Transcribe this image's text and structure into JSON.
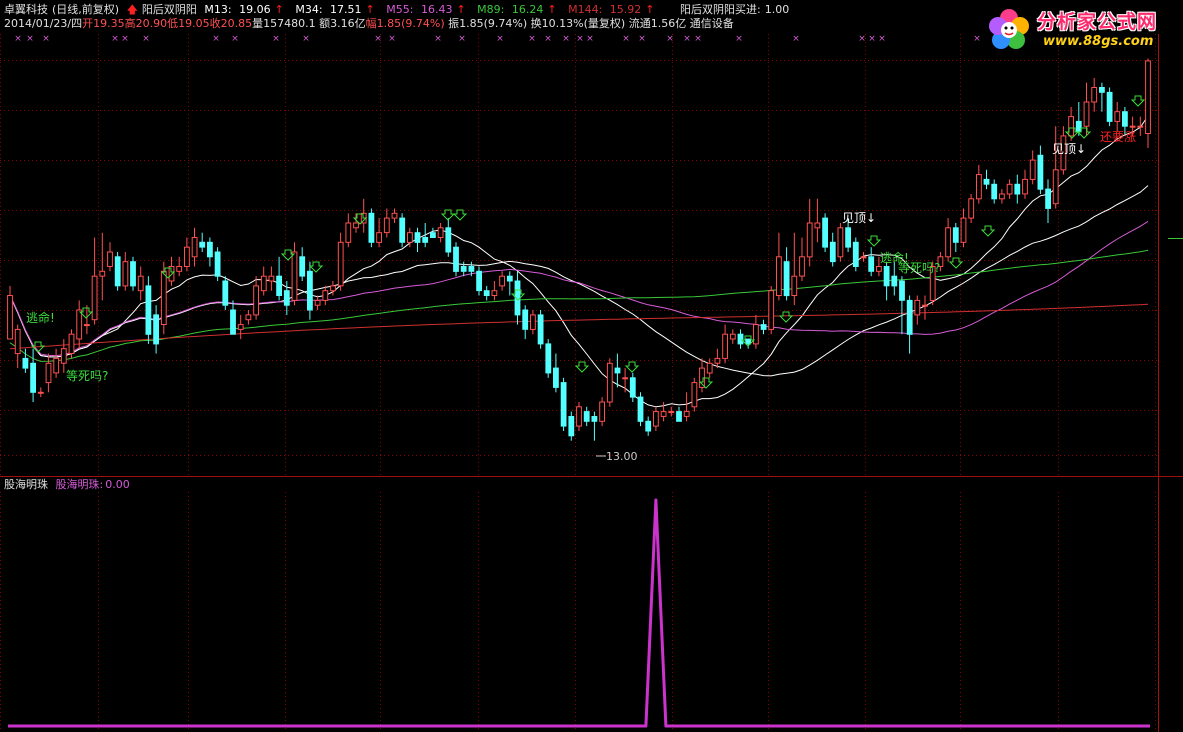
{
  "header": {
    "stock_name": "卓翼科技",
    "period": "(日线,前复权)",
    "indicator_name": "阳后双阴阳",
    "mas": [
      {
        "label": "M13:",
        "value": "19.06",
        "color": "#ffffff"
      },
      {
        "label": "M34:",
        "value": "17.51",
        "color": "#ffffff"
      },
      {
        "label": "M55:",
        "value": "16.43",
        "color": "#d65cd6"
      },
      {
        "label": "M89:",
        "value": "16.24",
        "color": "#38c838"
      },
      {
        "label": "M144:",
        "value": "15.92",
        "color": "#d03030"
      }
    ],
    "buy_signal_label": "阳后双阴阳买进:",
    "buy_signal_value": "1.00",
    "info_date": "2014/01/23/四",
    "info_open": "开19.35",
    "info_high": "高20.90",
    "info_low": "低19.05",
    "info_close": "收20.85",
    "info_volume": "量157480.1",
    "info_amount": "额3.16亿",
    "info_change": "幅1.85(9.74%)",
    "info_amplitude": "振1.85(9.74%)",
    "info_turnover": "换10.13%(量复权)",
    "info_float": "流通1.56亿",
    "info_sector": "通信设备"
  },
  "logo": {
    "title": "分析家公式网",
    "url": "www.88gs.com"
  },
  "annotations": {
    "escape": "逃命!",
    "wait_death": "等死吗?",
    "see_top": "见顶",
    "still_rising": "还要涨",
    "low_price": "13.00"
  },
  "sub_panel": {
    "title": "股海明珠",
    "indicator_label": "股海明珠:",
    "value": "0.00"
  },
  "colors": {
    "up_candle": "#ff5050",
    "down_candle": "#54ffff",
    "ma13": "#ffffff",
    "ma34": "#ffffff",
    "ma55": "#d65cd6",
    "ma89": "#38c838",
    "ma144": "#d03030",
    "signal_green": "#3cdc3c",
    "osc_line": "#cc33cc",
    "grid": "#8b0000",
    "arrow_up": "#ff2020"
  },
  "chart_data": {
    "type": "candlestick",
    "ylim": [
      12.6,
      21.2
    ],
    "low_marker": 13.0,
    "candles": [
      [
        15.1,
        16.0,
        15.1,
        16.2
      ],
      [
        14.8,
        15.3,
        14.5,
        15.4
      ],
      [
        14.7,
        14.5,
        14.4,
        14.9
      ],
      [
        14.6,
        14.0,
        13.8,
        14.9
      ],
      [
        14.0,
        14.0,
        13.9,
        14.1
      ],
      [
        14.2,
        14.6,
        14.0,
        14.8
      ],
      [
        14.4,
        14.7,
        14.3,
        14.9
      ],
      [
        14.6,
        14.9,
        14.4,
        15.1
      ],
      [
        14.8,
        15.2,
        14.7,
        15.3
      ],
      [
        15.1,
        15.7,
        14.9,
        15.9
      ],
      [
        15.4,
        15.4,
        15.2,
        15.8
      ],
      [
        15.5,
        16.4,
        15.4,
        17.2
      ],
      [
        16.4,
        16.5,
        15.9,
        17.3
      ],
      [
        16.6,
        16.9,
        16.5,
        17.1
      ],
      [
        16.8,
        16.2,
        16.1,
        16.9
      ],
      [
        16.2,
        16.7,
        16.1,
        16.9
      ],
      [
        16.7,
        16.2,
        16.1,
        16.8
      ],
      [
        16.1,
        16.4,
        15.9,
        16.6
      ],
      [
        16.2,
        15.2,
        15.0,
        16.4
      ],
      [
        15.6,
        15.0,
        14.8,
        15.8
      ],
      [
        15.4,
        16.5,
        15.2,
        16.7
      ],
      [
        16.3,
        16.6,
        16.2,
        16.8
      ],
      [
        16.5,
        16.6,
        16.4,
        16.8
      ],
      [
        16.6,
        17.0,
        16.5,
        17.2
      ],
      [
        16.8,
        17.2,
        16.6,
        17.4
      ],
      [
        17.1,
        17.0,
        16.9,
        17.3
      ],
      [
        17.1,
        16.8,
        16.6,
        17.2
      ],
      [
        16.9,
        16.4,
        16.3,
        17.0
      ],
      [
        16.3,
        15.8,
        15.7,
        16.4
      ],
      [
        15.7,
        15.2,
        15.2,
        15.9
      ],
      [
        15.3,
        15.4,
        15.1,
        15.6
      ],
      [
        15.5,
        15.6,
        15.4,
        15.7
      ],
      [
        15.6,
        16.2,
        15.5,
        16.4
      ],
      [
        16.1,
        16.4,
        16.0,
        16.6
      ],
      [
        16.3,
        16.4,
        16.1,
        16.6
      ],
      [
        16.4,
        16.0,
        15.9,
        16.8
      ],
      [
        16.1,
        15.8,
        15.6,
        16.3
      ],
      [
        15.9,
        16.9,
        15.8,
        17.1
      ],
      [
        16.8,
        16.4,
        16.3,
        17.0
      ],
      [
        16.5,
        15.7,
        15.5,
        16.7
      ],
      [
        15.8,
        15.9,
        15.7,
        16.0
      ],
      [
        15.9,
        16.1,
        15.8,
        16.2
      ],
      [
        16.1,
        16.2,
        16.0,
        16.3
      ],
      [
        16.2,
        17.1,
        16.1,
        17.3
      ],
      [
        17.1,
        17.5,
        17.0,
        17.7
      ],
      [
        17.4,
        17.5,
        17.3,
        17.7
      ],
      [
        17.5,
        17.7,
        17.3,
        18.0
      ],
      [
        17.7,
        17.1,
        17.0,
        17.8
      ],
      [
        17.1,
        17.3,
        17.0,
        17.6
      ],
      [
        17.3,
        17.6,
        17.2,
        17.8
      ],
      [
        17.6,
        17.7,
        17.5,
        17.8
      ],
      [
        17.6,
        17.1,
        17.0,
        17.7
      ],
      [
        17.1,
        17.3,
        17.0,
        17.4
      ],
      [
        17.3,
        17.1,
        16.9,
        17.4
      ],
      [
        17.2,
        17.1,
        17.0,
        17.5
      ],
      [
        17.3,
        17.2,
        17.2,
        17.4
      ],
      [
        17.2,
        17.4,
        17.1,
        17.5
      ],
      [
        17.4,
        16.9,
        16.8,
        17.6
      ],
      [
        17.0,
        16.5,
        16.4,
        17.1
      ],
      [
        16.6,
        16.5,
        16.4,
        16.7
      ],
      [
        16.6,
        16.5,
        16.4,
        16.7
      ],
      [
        16.5,
        16.1,
        16.0,
        16.6
      ],
      [
        16.1,
        16.0,
        15.9,
        16.2
      ],
      [
        16.0,
        16.1,
        15.9,
        16.3
      ],
      [
        16.2,
        16.4,
        16.1,
        16.5
      ],
      [
        16.4,
        16.3,
        16.0,
        16.5
      ],
      [
        16.3,
        15.6,
        15.4,
        16.5
      ],
      [
        15.7,
        15.3,
        15.1,
        15.8
      ],
      [
        15.3,
        15.6,
        15.2,
        15.7
      ],
      [
        15.6,
        15.0,
        14.9,
        15.7
      ],
      [
        15.0,
        14.4,
        14.3,
        15.1
      ],
      [
        14.5,
        14.1,
        14.0,
        14.8
      ],
      [
        14.2,
        13.3,
        13.2,
        14.3
      ],
      [
        13.5,
        13.1,
        13.0,
        13.6
      ],
      [
        13.3,
        13.7,
        13.2,
        13.8
      ],
      [
        13.6,
        13.4,
        13.3,
        13.7
      ],
      [
        13.5,
        13.4,
        13.0,
        13.6
      ],
      [
        13.4,
        13.8,
        13.3,
        13.9
      ],
      [
        13.8,
        14.6,
        13.7,
        14.7
      ],
      [
        14.5,
        14.4,
        14.1,
        14.8
      ],
      [
        14.3,
        14.3,
        14.0,
        14.5
      ],
      [
        14.3,
        13.9,
        13.8,
        14.4
      ],
      [
        13.9,
        13.4,
        13.3,
        14.0
      ],
      [
        13.4,
        13.2,
        13.1,
        13.5
      ],
      [
        13.3,
        13.6,
        13.2,
        13.7
      ],
      [
        13.5,
        13.6,
        13.4,
        13.8
      ],
      [
        13.6,
        13.6,
        13.5,
        13.7
      ],
      [
        13.6,
        13.4,
        13.4,
        13.7
      ],
      [
        13.5,
        13.6,
        13.4,
        14.0
      ],
      [
        13.7,
        14.2,
        13.6,
        14.3
      ],
      [
        14.1,
        14.5,
        14.0,
        14.7
      ],
      [
        14.4,
        14.6,
        14.3,
        14.7
      ],
      [
        14.6,
        14.7,
        14.5,
        14.9
      ],
      [
        14.7,
        15.2,
        14.6,
        15.4
      ],
      [
        15.1,
        15.2,
        15.0,
        15.3
      ],
      [
        15.2,
        15.0,
        14.9,
        15.3
      ],
      [
        15.1,
        15.0,
        14.9,
        15.1
      ],
      [
        15.0,
        15.4,
        14.9,
        15.6
      ],
      [
        15.4,
        15.3,
        15.2,
        15.5
      ],
      [
        15.3,
        16.1,
        15.2,
        16.2
      ],
      [
        16.0,
        16.8,
        15.9,
        17.3
      ],
      [
        16.7,
        16.0,
        15.9,
        17.0
      ],
      [
        16.0,
        16.4,
        15.8,
        17.3
      ],
      [
        16.4,
        16.8,
        16.3,
        17.2
      ],
      [
        16.8,
        17.5,
        16.6,
        18.0
      ],
      [
        17.4,
        17.5,
        17.1,
        18.0
      ],
      [
        17.6,
        17.0,
        16.9,
        17.7
      ],
      [
        17.1,
        16.7,
        16.6,
        17.3
      ],
      [
        16.8,
        17.4,
        16.7,
        17.5
      ],
      [
        17.4,
        17.0,
        16.9,
        17.6
      ],
      [
        17.1,
        16.6,
        16.5,
        17.2
      ],
      [
        16.8,
        16.8,
        16.7,
        16.9
      ],
      [
        16.8,
        16.5,
        16.4,
        17.0
      ],
      [
        16.5,
        16.6,
        16.4,
        16.8
      ],
      [
        16.6,
        16.2,
        15.9,
        16.7
      ],
      [
        16.4,
        16.2,
        16.0,
        16.7
      ],
      [
        16.3,
        15.9,
        15.2,
        16.4
      ],
      [
        15.9,
        15.2,
        14.8,
        16.0
      ],
      [
        15.6,
        15.9,
        15.4,
        16.0
      ],
      [
        15.8,
        15.8,
        15.5,
        16.0
      ],
      [
        15.9,
        16.6,
        15.8,
        16.7
      ],
      [
        16.6,
        16.8,
        16.5,
        16.9
      ],
      [
        16.8,
        17.4,
        16.7,
        17.6
      ],
      [
        17.4,
        17.1,
        16.9,
        17.5
      ],
      [
        17.1,
        17.6,
        17.0,
        17.8
      ],
      [
        17.6,
        18.0,
        17.5,
        18.1
      ],
      [
        18.0,
        18.5,
        17.9,
        18.7
      ],
      [
        18.4,
        18.3,
        18.2,
        18.6
      ],
      [
        18.3,
        18.0,
        17.9,
        18.4
      ],
      [
        18.0,
        18.1,
        17.9,
        18.2
      ],
      [
        18.1,
        18.3,
        18.0,
        18.4
      ],
      [
        18.3,
        18.1,
        17.9,
        18.5
      ],
      [
        18.1,
        18.4,
        18.0,
        18.6
      ],
      [
        18.4,
        18.8,
        18.3,
        19.0
      ],
      [
        18.9,
        18.2,
        18.1,
        19.1
      ],
      [
        18.2,
        17.8,
        17.5,
        18.4
      ],
      [
        17.9,
        18.6,
        17.8,
        19.5
      ],
      [
        18.6,
        19.3,
        18.5,
        19.5
      ],
      [
        19.3,
        19.7,
        19.2,
        19.9
      ],
      [
        19.6,
        19.4,
        19.3,
        20.0
      ],
      [
        19.5,
        20.0,
        19.3,
        20.4
      ],
      [
        20.0,
        20.3,
        19.8,
        20.5
      ],
      [
        20.3,
        20.2,
        19.8,
        20.4
      ],
      [
        20.2,
        19.6,
        19.5,
        20.3
      ],
      [
        19.6,
        19.8,
        19.4,
        20.0
      ],
      [
        19.8,
        19.5,
        19.3,
        19.9
      ],
      [
        19.5,
        19.5,
        19.3,
        19.7
      ],
      [
        19.5,
        19.5,
        19.3,
        19.7
      ],
      [
        19.35,
        20.85,
        19.05,
        20.9
      ]
    ],
    "oscillator": {
      "peak_index": 84,
      "peak_value": 1.0,
      "baseline": 0.0
    }
  }
}
